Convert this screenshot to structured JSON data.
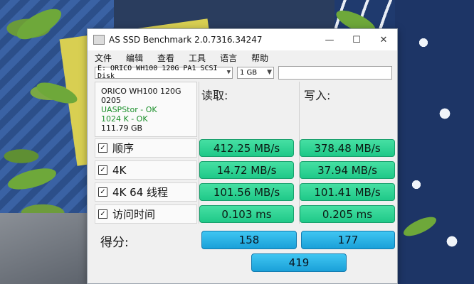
{
  "window": {
    "title": "AS SSD Benchmark 2.0.7316.34247",
    "minimize": "—",
    "maximize": "☐",
    "close": "✕"
  },
  "menu": [
    "文件",
    "编辑",
    "查看",
    "工具",
    "语言",
    "帮助"
  ],
  "toolbar": {
    "drive": "E: ORICO WH100 120G PA1 SCSI Disk",
    "size": "1 GB"
  },
  "info": {
    "model": "ORICO WH100 120G",
    "firmware": "0205",
    "driver": "UASPStor - OK",
    "alignment": "1024 K - OK",
    "capacity": "111.79 GB"
  },
  "headers": {
    "read": "读取:",
    "write": "写入:"
  },
  "rows": [
    {
      "label": "顺序",
      "read": "412.25 MB/s",
      "write": "378.48 MB/s"
    },
    {
      "label": "4K",
      "read": "14.72 MB/s",
      "write": "37.94 MB/s"
    },
    {
      "label": "4K 64 线程",
      "read": "101.56 MB/s",
      "write": "101.41 MB/s"
    },
    {
      "label": "访问时间",
      "read": "0.103 ms",
      "write": "0.205 ms"
    }
  ],
  "score": {
    "label": "得分:",
    "read": "158",
    "write": "177",
    "total": "419"
  },
  "colors": {
    "result_green": "#2fd494",
    "score_blue": "#2bb2e6"
  }
}
